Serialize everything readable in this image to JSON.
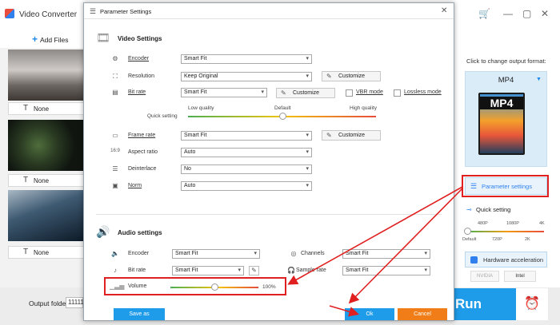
{
  "app": {
    "title": "Video Converter",
    "add_files": "Add Files",
    "subtitles": [
      "None",
      "None",
      "None"
    ],
    "output_folder_label": "Output folder:",
    "output_folder_value": "11111",
    "win_controls": [
      "—",
      "▢",
      "✕"
    ]
  },
  "right_panel": {
    "hint": "Click to change output format:",
    "format": "MP4",
    "format_icon_text": "MP4",
    "param_button": "Parameter settings",
    "quick_setting": "Quick setting",
    "ticks_top": [
      "480P",
      "1080P",
      "4K"
    ],
    "ticks_bottom": [
      "Default",
      "720P",
      "2K"
    ],
    "hw_accel": "Hardware acceleration",
    "chips": [
      "NVIDIA",
      "Intel"
    ],
    "run": "Run"
  },
  "dialog": {
    "title": "Parameter Settings",
    "video": {
      "section": "Video Settings",
      "encoder_label": "Encoder",
      "encoder_value": "Smart Fit",
      "resolution_label": "Resolution",
      "resolution_value": "Keep Original",
      "bitrate_label": "Bit rate",
      "bitrate_value": "Smart Fit",
      "customize": "Customize",
      "vbr_label": "VBR mode",
      "lossless_label": "Lossless mode",
      "quick_label": "Quick setting",
      "low_quality": "Low quality",
      "default": "Default",
      "high_quality": "High quality",
      "quality_level": 0.5,
      "framerate_label": "Frame rate",
      "framerate_value": "Smart Fit",
      "aspect_label": "Aspect ratio",
      "aspect_value": "Auto",
      "deinterlace_label": "Deinterlace",
      "deinterlace_value": "No",
      "norm_label": "Norm",
      "norm_value": "Auto"
    },
    "audio": {
      "section": "Audio settings",
      "encoder_label": "Encoder",
      "encoder_value": "Smart Fit",
      "bitrate_label": "Bit rate",
      "bitrate_value": "Smart Fit",
      "channels_label": "Channels",
      "channels_value": "Smart Fit",
      "samplerate_label": "Sample rate",
      "samplerate_value": "Smart Fit",
      "volume_label": "Volume",
      "volume_value": "100%",
      "volume_level": 0.5
    },
    "save_as": "Save as",
    "ok": "Ok",
    "cancel": "Cancel"
  },
  "colors": {
    "accent": "#1e9be9",
    "cancel": "#f07d17",
    "highlight": "#e02020"
  }
}
